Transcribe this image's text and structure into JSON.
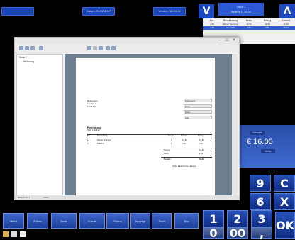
{
  "topbar": {
    "label_left": "",
    "label_mid": "Datum: 01.02.2017",
    "label_right": "Version: 18.04.15",
    "status_title": "Tisch 1",
    "status_sub": "Kellner 1, 15:32"
  },
  "grid": {
    "headers": [
      "Anz.",
      "Bezeichnung",
      "Preis",
      "Betrag",
      "Gesamt"
    ],
    "rows": [
      [
        "1.00",
        "Wiener Schnitzel",
        "12.50",
        "12.50",
        "12.50"
      ],
      [
        "1.00",
        "Cola 0,5",
        "3.50",
        "3.50",
        "16.00"
      ]
    ]
  },
  "total": {
    "tag": "Gesamt",
    "amount": "€ 16.00",
    "sub": "Netto"
  },
  "keypad": {
    "keys": [
      "9",
      "C",
      "6",
      "X",
      "1",
      "2",
      "3",
      "0",
      "00",
      ",",
      "OK"
    ]
  },
  "bottom_buttons": [
    "Menü",
    "Extras",
    "Preis",
    "Kunde",
    "Storno",
    "Anzeige",
    "Tisch",
    "Bon",
    "Zahlen"
  ],
  "window": {
    "tree_root": "Seite 1",
    "tree_child": "Rechnung",
    "status": "Seite 1 von 1",
    "zoom": "100%"
  },
  "doc": {
    "addr1": "Mustermann",
    "addr2": "Hauptstr. 1",
    "addr3": "12345 Ort",
    "box_lines": [
      "Rechnung Nr.",
      "Datum",
      "Kunde",
      "Seite"
    ],
    "heading": "Rechnung",
    "subheading": "Tisch 1, Kellner 1",
    "cols": [
      "Pos",
      "Bezeichnung",
      "Menge",
      "E-Preis",
      "Betrag"
    ],
    "row1": [
      "1",
      "Wiener Schnitzel",
      "1",
      "12.50",
      "12.50"
    ],
    "row2": [
      "2",
      "Cola 0,5",
      "1",
      "3.50",
      "3.50"
    ],
    "sum_label": "Summe",
    "sum_val": "16.00",
    "tax_label": "MwSt",
    "tax_val": "2.56",
    "total_label": "Gesamt",
    "total_val": "16.00",
    "footer": "Vielen Dank für Ihren Besuch"
  }
}
